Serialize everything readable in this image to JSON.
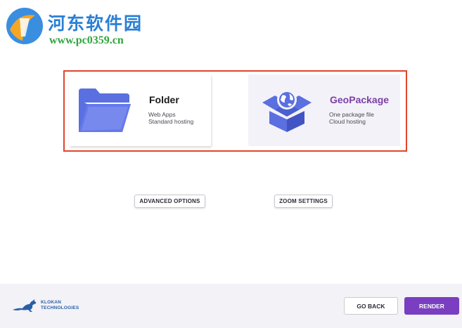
{
  "watermark": {
    "title": "河东软件园",
    "url": "www.pc0359.cn"
  },
  "options": [
    {
      "title": "Folder",
      "line1": "Web Apps",
      "line2": "Standard hosting",
      "icon": "folder-icon",
      "title_color": "#1a1a1a"
    },
    {
      "title": "GeoPackage",
      "line1": "One package file",
      "line2": "Cloud hosting",
      "icon": "geopackage-box-icon",
      "title_color": "#7b3fa6"
    }
  ],
  "buttons": {
    "advanced": "ADVANCED OPTIONS",
    "zoom": "ZOOM SETTINGS",
    "back": "GO BACK",
    "render": "RENDER"
  },
  "footer": {
    "brand_line1": "KLOKAN",
    "brand_line2": "TECHNOLOGIES",
    "logo_icon": "kangaroo-icon"
  },
  "colors": {
    "accent": "#7a3ec0",
    "selection_border": "#e0452a",
    "icon_blue": "#5a6fe0"
  }
}
